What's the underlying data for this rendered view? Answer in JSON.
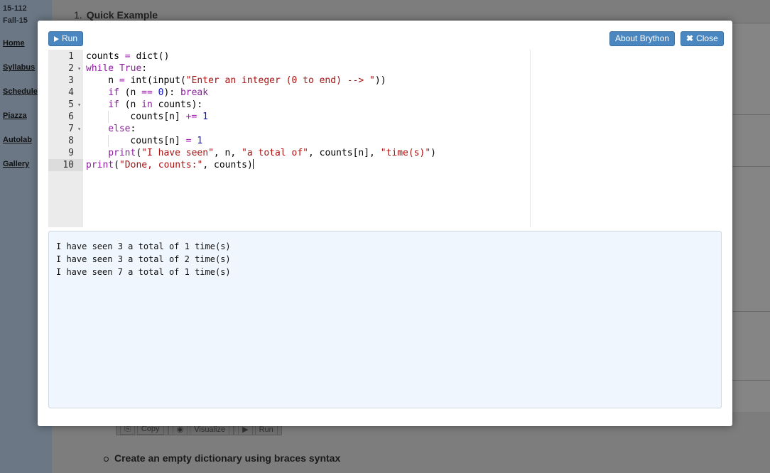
{
  "background": {
    "course_code": "15-112",
    "term": "Fall-15",
    "nav": [
      "Home",
      "Syllabus",
      "Schedule",
      "Piazza",
      "Autolab",
      "Gallery"
    ],
    "section_number": "1.",
    "section_title": "Quick Example",
    "bottom_bullet": "Create an empty dictionary using braces syntax",
    "toolbar": [
      "Copy",
      "Visualize",
      "Run"
    ]
  },
  "modal": {
    "run_label": "Run",
    "about_label": "About Brython",
    "close_label": "Close",
    "active_line": 10,
    "code_lines": [
      {
        "num": "1",
        "fold": false,
        "indent": 0,
        "tokens": [
          [
            "t",
            "counts "
          ],
          [
            "o",
            "="
          ],
          [
            "t",
            " dict()"
          ]
        ]
      },
      {
        "num": "2",
        "fold": true,
        "indent": 0,
        "tokens": [
          [
            "k",
            "while"
          ],
          [
            "t",
            " "
          ],
          [
            "k",
            "True"
          ],
          [
            "t",
            ":"
          ]
        ]
      },
      {
        "num": "3",
        "fold": false,
        "indent": 1,
        "tokens": [
          [
            "t",
            "n "
          ],
          [
            "o",
            "="
          ],
          [
            "t",
            " int(input("
          ],
          [
            "s",
            "\"Enter an integer (0 to end) --> \""
          ],
          [
            "t",
            "))"
          ]
        ]
      },
      {
        "num": "4",
        "fold": false,
        "indent": 1,
        "tokens": [
          [
            "k",
            "if"
          ],
          [
            "t",
            " (n "
          ],
          [
            "o",
            "=="
          ],
          [
            "t",
            " "
          ],
          [
            "n",
            "0"
          ],
          [
            "t",
            "): "
          ],
          [
            "k",
            "break"
          ]
        ]
      },
      {
        "num": "5",
        "fold": true,
        "indent": 1,
        "tokens": [
          [
            "k",
            "if"
          ],
          [
            "t",
            " (n "
          ],
          [
            "k",
            "in"
          ],
          [
            "t",
            " counts):"
          ]
        ]
      },
      {
        "num": "6",
        "fold": false,
        "indent": 2,
        "tokens": [
          [
            "t",
            "counts[n] "
          ],
          [
            "o",
            "+="
          ],
          [
            "t",
            " "
          ],
          [
            "n",
            "1"
          ]
        ]
      },
      {
        "num": "7",
        "fold": true,
        "indent": 1,
        "tokens": [
          [
            "k",
            "else"
          ],
          [
            "t",
            ":"
          ]
        ]
      },
      {
        "num": "8",
        "fold": false,
        "indent": 2,
        "tokens": [
          [
            "t",
            "counts[n] "
          ],
          [
            "o",
            "="
          ],
          [
            "t",
            " "
          ],
          [
            "n",
            "1"
          ]
        ]
      },
      {
        "num": "9",
        "fold": false,
        "indent": 1,
        "tokens": [
          [
            "k",
            "print"
          ],
          [
            "t",
            "("
          ],
          [
            "s",
            "\"I have seen\""
          ],
          [
            "t",
            ", n, "
          ],
          [
            "s",
            "\"a total of\""
          ],
          [
            "t",
            ", counts[n], "
          ],
          [
            "s",
            "\"time(s)\""
          ],
          [
            "t",
            ")"
          ]
        ]
      },
      {
        "num": "10",
        "fold": false,
        "indent": 0,
        "tokens": [
          [
            "k",
            "print"
          ],
          [
            "t",
            "("
          ],
          [
            "s",
            "\"Done, counts:\""
          ],
          [
            "t",
            ", counts)"
          ]
        ]
      }
    ],
    "output_lines": [
      "I have seen 3 a total of 1 time(s)",
      "I have seen 3 a total of 2 time(s)",
      "I have seen 7 a total of 1 time(s)"
    ]
  }
}
